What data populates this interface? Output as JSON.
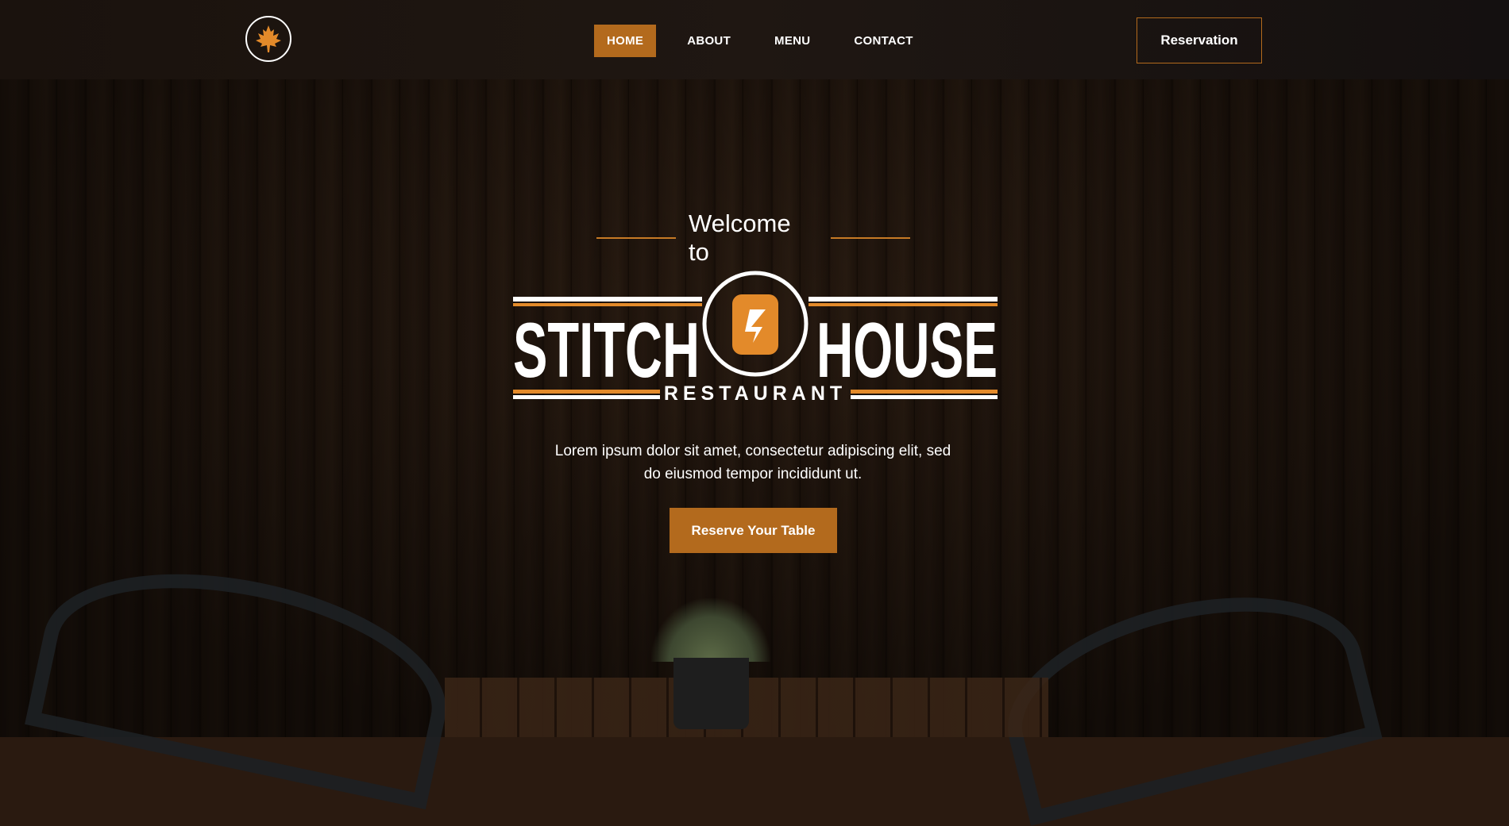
{
  "nav": {
    "items": [
      {
        "label": "HOME",
        "active": true
      },
      {
        "label": "ABOUT",
        "active": false
      },
      {
        "label": "MENU",
        "active": false
      },
      {
        "label": "CONTACT",
        "active": false
      }
    ],
    "reservation_label": "Reservation",
    "logo_icon": "maple-leaf-icon"
  },
  "hero": {
    "welcome": "Welcome to",
    "brand_left": "STITCH",
    "brand_right": "HOUSE",
    "brand_sub": "RESTAURANT",
    "tagline": "Lorem ipsum dolor sit amet, consectetur adipiscing elit, sed do eiusmod tempor incididunt ut.",
    "cta_label": "Reserve Your Table"
  },
  "colors": {
    "accent": "#b36a1d",
    "brand_orange": "#e38a2a",
    "header_bg": "#1a120d",
    "text": "#ffffff"
  }
}
